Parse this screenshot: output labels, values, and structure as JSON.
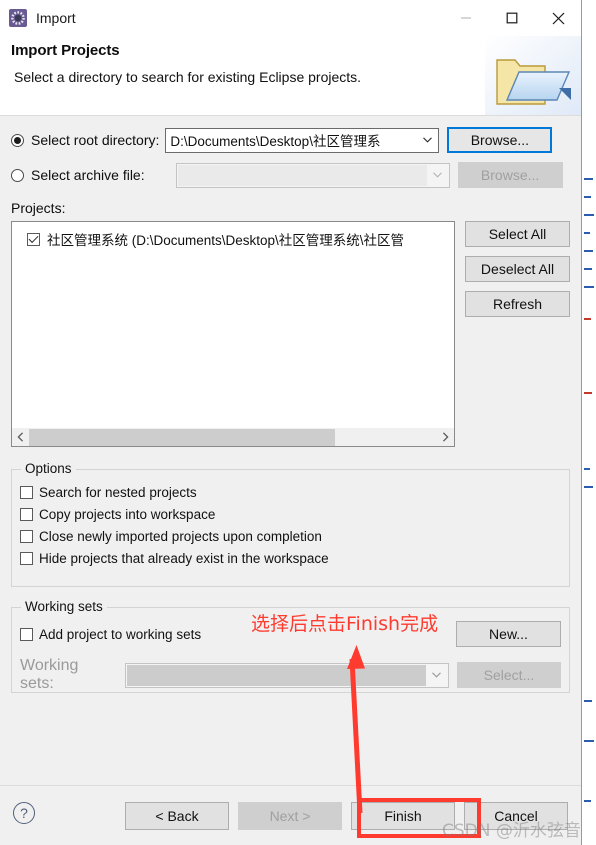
{
  "window": {
    "title": "Import",
    "icon": "import-wizard-icon",
    "controls": {
      "minimize": "minimize-icon",
      "maximize": "maximize-icon",
      "close": "close-icon"
    }
  },
  "banner": {
    "title": "Import Projects",
    "subtitle": "Select a directory to search for existing Eclipse projects.",
    "art": "open-folder-icon"
  },
  "source": {
    "root_directory": {
      "radio_label": "Select root directory:",
      "selected": true,
      "value": "D:\\Documents\\Desktop\\社区管理系",
      "browse_label": "Browse...",
      "browse_enabled": true
    },
    "archive_file": {
      "radio_label": "Select archive file:",
      "selected": false,
      "value": "",
      "browse_label": "Browse...",
      "browse_enabled": false
    }
  },
  "projects": {
    "label": "Projects:",
    "items": [
      {
        "checked": true,
        "text": "社区管理系统 (D:\\Documents\\Desktop\\社区管理系统\\社区管"
      }
    ],
    "buttons": [
      {
        "label": "Select All",
        "enabled": true
      },
      {
        "label": "Deselect All",
        "enabled": true
      },
      {
        "label": "Refresh",
        "enabled": true
      }
    ],
    "scrollbar": {
      "left_arrow": "chevron-left-icon",
      "right_arrow": "chevron-right-icon",
      "thumb_percent": 75
    }
  },
  "options": {
    "legend": "Options",
    "items": [
      {
        "label": "Search for nested projects",
        "checked": false
      },
      {
        "label": "Copy projects into workspace",
        "checked": false
      },
      {
        "label": "Close newly imported projects upon completion",
        "checked": false
      },
      {
        "label": "Hide projects that already exist in the workspace",
        "checked": false
      }
    ]
  },
  "working_sets": {
    "legend": "Working sets",
    "add_checkbox": {
      "label": "Add project to working sets",
      "checked": false
    },
    "field_label": "Working sets:",
    "field_value": "",
    "field_enabled": false,
    "new_button": {
      "label": "New...",
      "enabled": true
    },
    "select_button": {
      "label": "Select...",
      "enabled": false
    }
  },
  "footer": {
    "help": "help-icon",
    "buttons": [
      {
        "label": "< Back",
        "enabled": true
      },
      {
        "label": "Next >",
        "enabled": false
      },
      {
        "label": "Finish",
        "enabled": true,
        "highlighted": true
      },
      {
        "label": "Cancel",
        "enabled": true
      }
    ]
  },
  "annotations": {
    "note_text": "选择后点击Finish完成",
    "note_color": "#ff3b30",
    "arrow": "red-up-arrow",
    "highlight_target": "Finish",
    "watermark": "CSDN @沂水弦音"
  }
}
